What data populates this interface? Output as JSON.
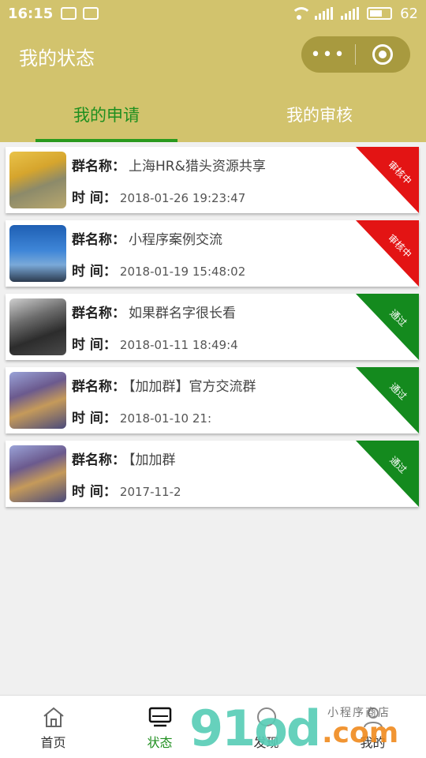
{
  "status_bar": {
    "time": "16:15",
    "battery": "62",
    "battery_level": 0.62
  },
  "navbar": {
    "title": "我的状态",
    "more_label": "•••"
  },
  "tabs": [
    {
      "label": "我的申请",
      "active": true
    },
    {
      "label": "我的审核",
      "active": false
    }
  ],
  "labels": {
    "group_name": "群名称：",
    "time": "时 间："
  },
  "items": [
    {
      "name": "上海HR&猎头资源共享",
      "time": "2018-01-26 19:23:47",
      "status": "审核中",
      "status_color": "#e31414"
    },
    {
      "name": "小程序案例交流",
      "time": "2018-01-19 15:48:02",
      "status": "审核中",
      "status_color": "#e31414"
    },
    {
      "name": "如果群名字很长看",
      "time": "2018-01-11 18:49:4",
      "status": "通过",
      "status_color": "#148a1e"
    },
    {
      "name": "【加加群】官方交流群",
      "time": "2018-01-10 21:",
      "status": "通过",
      "status_color": "#148a1e"
    },
    {
      "name": "【加加群",
      "time": "2017-11-2",
      "status": "通过",
      "status_color": "#148a1e"
    }
  ],
  "bottom_nav": [
    {
      "label": "首页",
      "icon": "home-icon",
      "active": false
    },
    {
      "label": "状态",
      "icon": "monitor-icon",
      "active": true
    },
    {
      "label": "发现",
      "icon": "discover-icon",
      "active": false
    },
    {
      "label": "我的",
      "icon": "user-icon",
      "active": false
    }
  ],
  "watermark": {
    "main": "91od",
    "dot": ".com",
    "sub": "小程序商店"
  },
  "colors": {
    "header": "#d2c36d",
    "accent": "#1f8f1f",
    "pending": "#e31414",
    "pass": "#148a1e"
  }
}
